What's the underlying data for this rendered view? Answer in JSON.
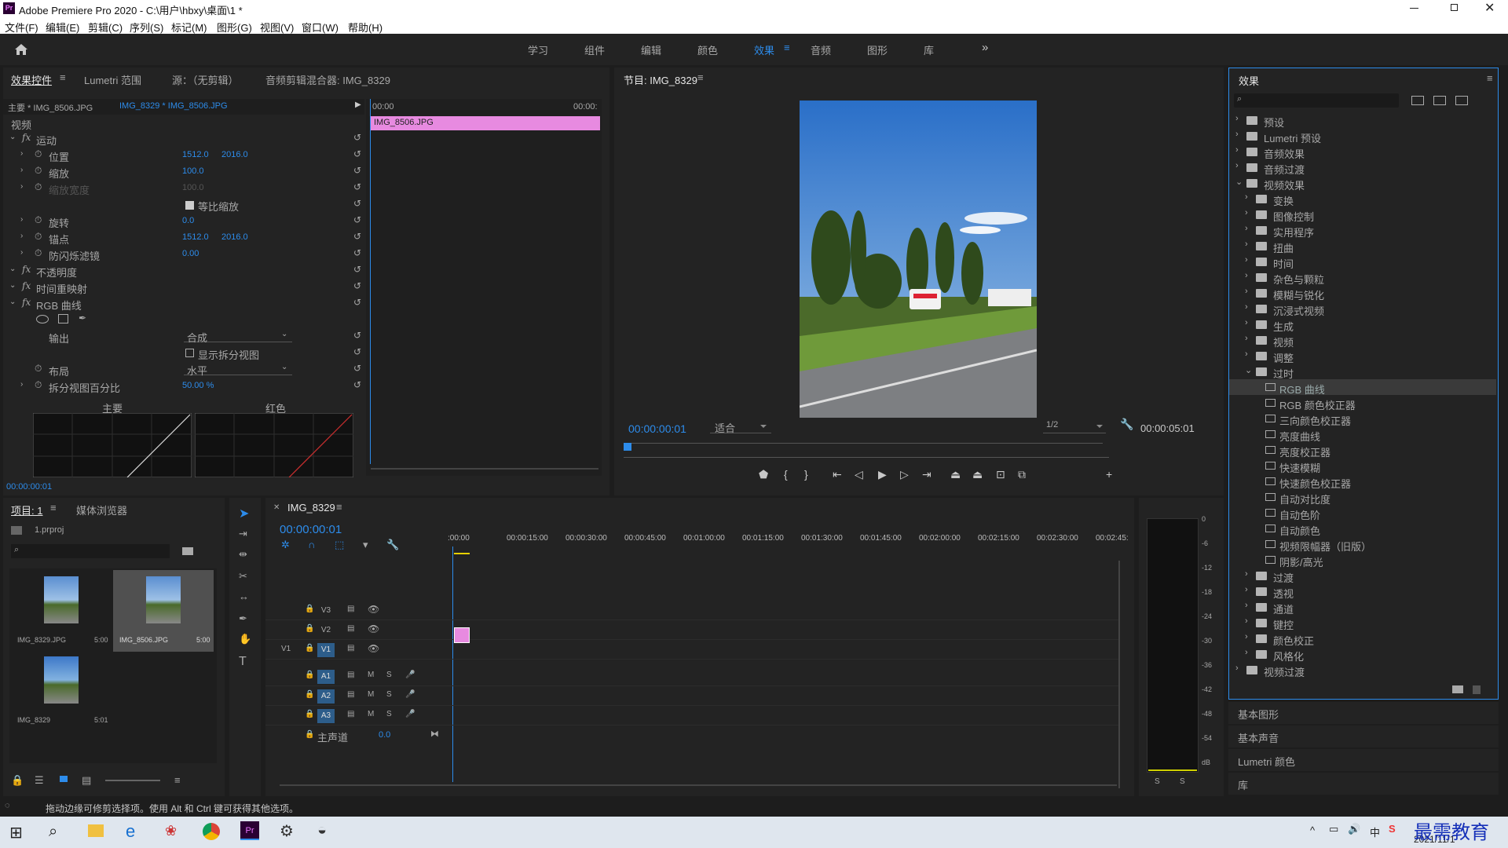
{
  "window": {
    "title": "Adobe Premiere Pro 2020 - C:\\用户\\hbxy\\桌面\\1 *",
    "app_icon": "Pr"
  },
  "menu": [
    "文件(F)",
    "编辑(E)",
    "剪辑(C)",
    "序列(S)",
    "标记(M)",
    "图形(G)",
    "视图(V)",
    "窗口(W)",
    "帮助(H)"
  ],
  "workspaces": [
    "学习",
    "组件",
    "编辑",
    "颜色",
    "效果",
    "音频",
    "图形",
    "库"
  ],
  "workspace_active": "效果",
  "effect_controls": {
    "tabs": [
      "效果控件",
      "Lumetri 范围",
      "源：（无剪辑）",
      "音频剪辑混合器: IMG_8329"
    ],
    "master": "主要 * IMG_8506.JPG",
    "seq": "IMG_8329 * IMG_8506.JPG",
    "time_start": "00:00",
    "time_end": "00:00:",
    "clip_name": "IMG_8506.JPG",
    "video_label": "视频",
    "rows": [
      {
        "name": "运动",
        "fx": true
      },
      {
        "name": "位置",
        "v1": "1512.0",
        "v2": "2016.0"
      },
      {
        "name": "缩放",
        "v1": "100.0"
      },
      {
        "name": "缩放宽度",
        "v1": "100.0",
        "disabled": true
      },
      {
        "name": "等比缩放",
        "checkbox": true
      },
      {
        "name": "旋转",
        "v1": "0.0"
      },
      {
        "name": "锚点",
        "v1": "1512.0",
        "v2": "2016.0"
      },
      {
        "name": "防闪烁滤镜",
        "v1": "0.00"
      },
      {
        "name": "不透明度",
        "fx": true
      },
      {
        "name": "时间重映射",
        "fx": true
      },
      {
        "name": "RGB 曲线",
        "fx": true
      }
    ],
    "output_label": "输出",
    "output_value": "合成",
    "split_label": "显示拆分视图",
    "layout_label": "布局",
    "layout_value": "水平",
    "split_pct_label": "拆分视图百分比",
    "split_pct_value": "50.00 %",
    "curve_main": "主要",
    "curve_red": "红色",
    "timecode": "00:00:00:01"
  },
  "program": {
    "title": "节目: IMG_8329",
    "timecode": "00:00:00:01",
    "fit": "适合",
    "res": "1/2",
    "duration": "00:00:05:01"
  },
  "effects_panel": {
    "title": "效果",
    "top": [
      "预设",
      "Lumetri 预设",
      "音频效果",
      "音频过渡",
      "视频效果"
    ],
    "video_effects": [
      "变换",
      "图像控制",
      "实用程序",
      "扭曲",
      "时间",
      "杂色与颗粒",
      "模糊与锐化",
      "沉浸式视频",
      "生成",
      "视频",
      "调整",
      "过时"
    ],
    "obsolete": [
      "RGB 曲线",
      "RGB 颜色校正器",
      "三向颜色校正器",
      "亮度曲线",
      "亮度校正器",
      "快速模糊",
      "快速颜色校正器",
      "自动对比度",
      "自动色阶",
      "自动颜色",
      "视频限幅器（旧版）",
      "阴影/高光"
    ],
    "after": [
      "过渡",
      "透视",
      "通道",
      "键控",
      "颜色校正",
      "风格化"
    ],
    "last": "视频过渡",
    "sections": [
      "基本图形",
      "基本声音",
      "Lumetri 颜色",
      "库"
    ]
  },
  "project": {
    "tabs": [
      "项目: 1",
      "媒体浏览器"
    ],
    "file": "1.prproj",
    "items": [
      {
        "name": "IMG_8329.JPG",
        "dur": "5:00"
      },
      {
        "name": "IMG_8506.JPG",
        "dur": "5:00"
      },
      {
        "name": "IMG_8329",
        "dur": "5:01"
      }
    ]
  },
  "timeline": {
    "tab": "IMG_8329",
    "timecode": "00:00:00:01",
    "ruler": [
      ":00:00",
      "00:00:15:00",
      "00:00:30:00",
      "00:00:45:00",
      "00:01:00:00",
      "00:01:15:00",
      "00:01:30:00",
      "00:01:45:00",
      "00:02:00:00",
      "00:02:15:00",
      "00:02:30:00",
      "00:02:45:"
    ],
    "video_tracks": [
      "V3",
      "V2",
      "V1"
    ],
    "audio_tracks": [
      "A1",
      "A2",
      "A3"
    ],
    "src": "V1",
    "master": "主声道",
    "master_val": "0.0"
  },
  "meter": {
    "ticks": [
      "0",
      "-6",
      "-12",
      "-18",
      "-24",
      "-30",
      "-36",
      "-42",
      "-48",
      "-54",
      "dB"
    ],
    "solo": [
      "S",
      "S"
    ]
  },
  "status": "拖动边缘可修剪选择项。使用 Alt 和 Ctrl 键可获得其他选项。",
  "taskbar": {
    "date": "2021/11/1",
    "watermark": "最需教育",
    "ime": "中"
  }
}
